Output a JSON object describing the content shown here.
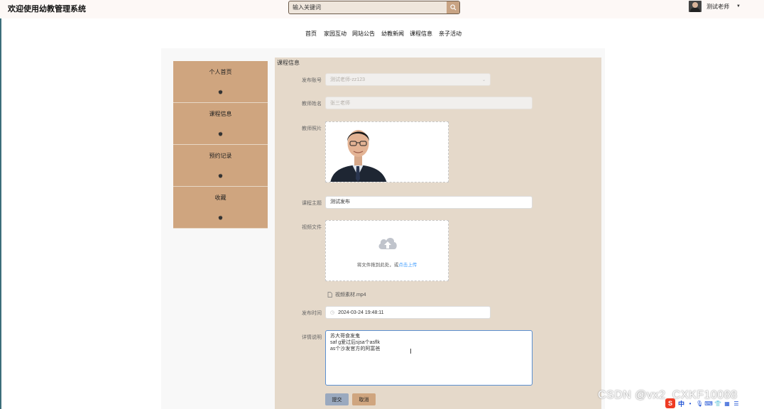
{
  "header": {
    "site_title": "欢迎使用幼教管理系统",
    "search_placeholder": "输入关键词",
    "user_name": "测试老师"
  },
  "nav": {
    "items": [
      "首页",
      "家园互动",
      "网站公告",
      "幼教新闻",
      "课程信息",
      "亲子活动"
    ]
  },
  "sidebar": {
    "items": [
      {
        "label": "个人首页",
        "icon": "apple-icon"
      },
      {
        "label": "课程信息",
        "icon": "apple-icon"
      },
      {
        "label": "预约记录",
        "icon": "apple-icon"
      },
      {
        "label": "收藏",
        "icon": "apple-icon"
      }
    ]
  },
  "form": {
    "section_title": "课程信息",
    "publish_account": {
      "label": "发布账号",
      "value": "测试老师-zz123"
    },
    "teacher_name": {
      "label": "教师姓名",
      "value": "张三老师"
    },
    "teacher_photo": {
      "label": "教师照片"
    },
    "course_topic": {
      "label": "课程主题",
      "value": "测试发布"
    },
    "video_file": {
      "label": "视频文件",
      "upload_hint": "将文件拖到此处，或",
      "upload_link": "点击上传",
      "file_name": "视频素材.mp4"
    },
    "publish_time": {
      "label": "发布时间",
      "value": "2024-03-24 19:48:11"
    },
    "details": {
      "label": "详情说明",
      "value": "苏大哥食发鬼\nsaf g爱过后sjsa个asflk\nas个沙发官方的阿富爸"
    },
    "submit_label": "提交",
    "cancel_label": "取消"
  },
  "watermark": "CSDN @vx2_CXKF10088",
  "ime": {
    "logo": "S",
    "lang": "中"
  },
  "colors": {
    "sidebar": "#cfa57f",
    "content_bg": "#e5d9ca",
    "submit": "#9aa9bf",
    "cancel": "#cfa57f",
    "link": "#409eff"
  }
}
